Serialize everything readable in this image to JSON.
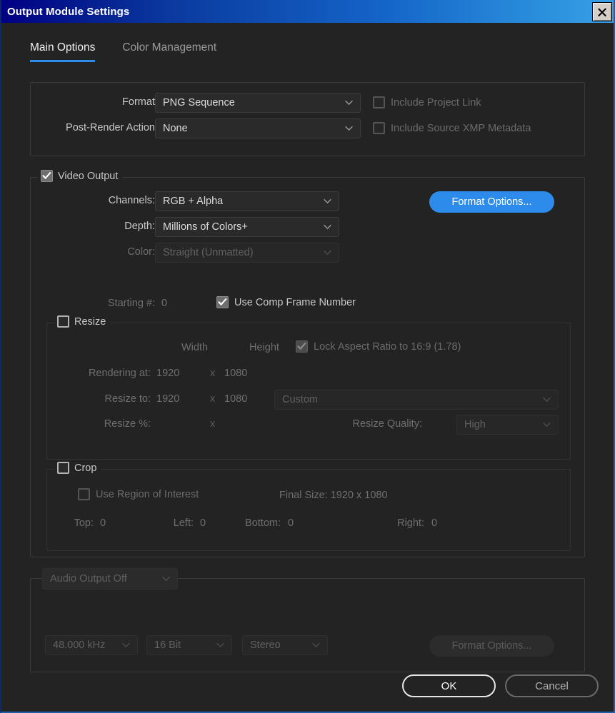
{
  "window": {
    "title": "Output Module Settings",
    "close_icon": "close-x-icon"
  },
  "tabs": [
    {
      "label": "Main Options",
      "active": true
    },
    {
      "label": "Color Management",
      "active": false
    }
  ],
  "format_section": {
    "format_label": "Format:",
    "format_value": "PNG Sequence",
    "post_render_label": "Post-Render Action:",
    "post_render_value": "None",
    "include_project_link": {
      "label": "Include Project Link",
      "checked": false,
      "enabled": false
    },
    "include_xmp": {
      "label": "Include Source XMP Metadata",
      "checked": false,
      "enabled": false
    }
  },
  "video_output": {
    "group_label": "Video Output",
    "group_checked": true,
    "channels_label": "Channels:",
    "channels_value": "RGB + Alpha",
    "depth_label": "Depth:",
    "depth_value": "Millions of Colors+",
    "color_label": "Color:",
    "color_value": "Straight (Unmatted)",
    "starting_label": "Starting #:",
    "starting_value": "0",
    "use_comp_frame_number": {
      "label": "Use Comp Frame Number",
      "checked": true
    },
    "format_options_button": "Format Options..."
  },
  "resize": {
    "group_label": "Resize",
    "group_checked": false,
    "width_header": "Width",
    "height_header": "Height",
    "lock_aspect": {
      "label": "Lock Aspect Ratio to 16:9 (1.78)",
      "checked": true
    },
    "rendering_at_label": "Rendering at:",
    "rendering_at_width": "1920",
    "rendering_at_x": "x",
    "rendering_at_height": "1080",
    "resize_to_label": "Resize to:",
    "resize_to_width": "1920",
    "resize_to_x": "x",
    "resize_to_height": "1080",
    "resize_preset_value": "Custom",
    "resize_pct_label": "Resize %:",
    "resize_pct_x": "x",
    "resize_quality_label": "Resize Quality:",
    "resize_quality_value": "High"
  },
  "crop": {
    "group_label": "Crop",
    "group_checked": false,
    "use_region_of_interest": {
      "label": "Use Region of Interest",
      "checked": false
    },
    "final_size": "Final Size: 1920 x 1080",
    "top_label": "Top:",
    "top_value": "0",
    "left_label": "Left:",
    "left_value": "0",
    "bottom_label": "Bottom:",
    "bottom_value": "0",
    "right_label": "Right:",
    "right_value": "0"
  },
  "audio_output": {
    "group_label": "Audio Output Off",
    "sample_rate": "48.000 kHz",
    "bit_depth": "16 Bit",
    "channels": "Stereo",
    "format_options_button": "Format Options..."
  },
  "footer": {
    "ok_label": "OK",
    "cancel_label": "Cancel"
  },
  "colors": {
    "accent_blue": "#2d8ceb",
    "titlebar_left": "#000082",
    "titlebar_right": "#3aa0e6",
    "panel_bg": "#232323"
  }
}
